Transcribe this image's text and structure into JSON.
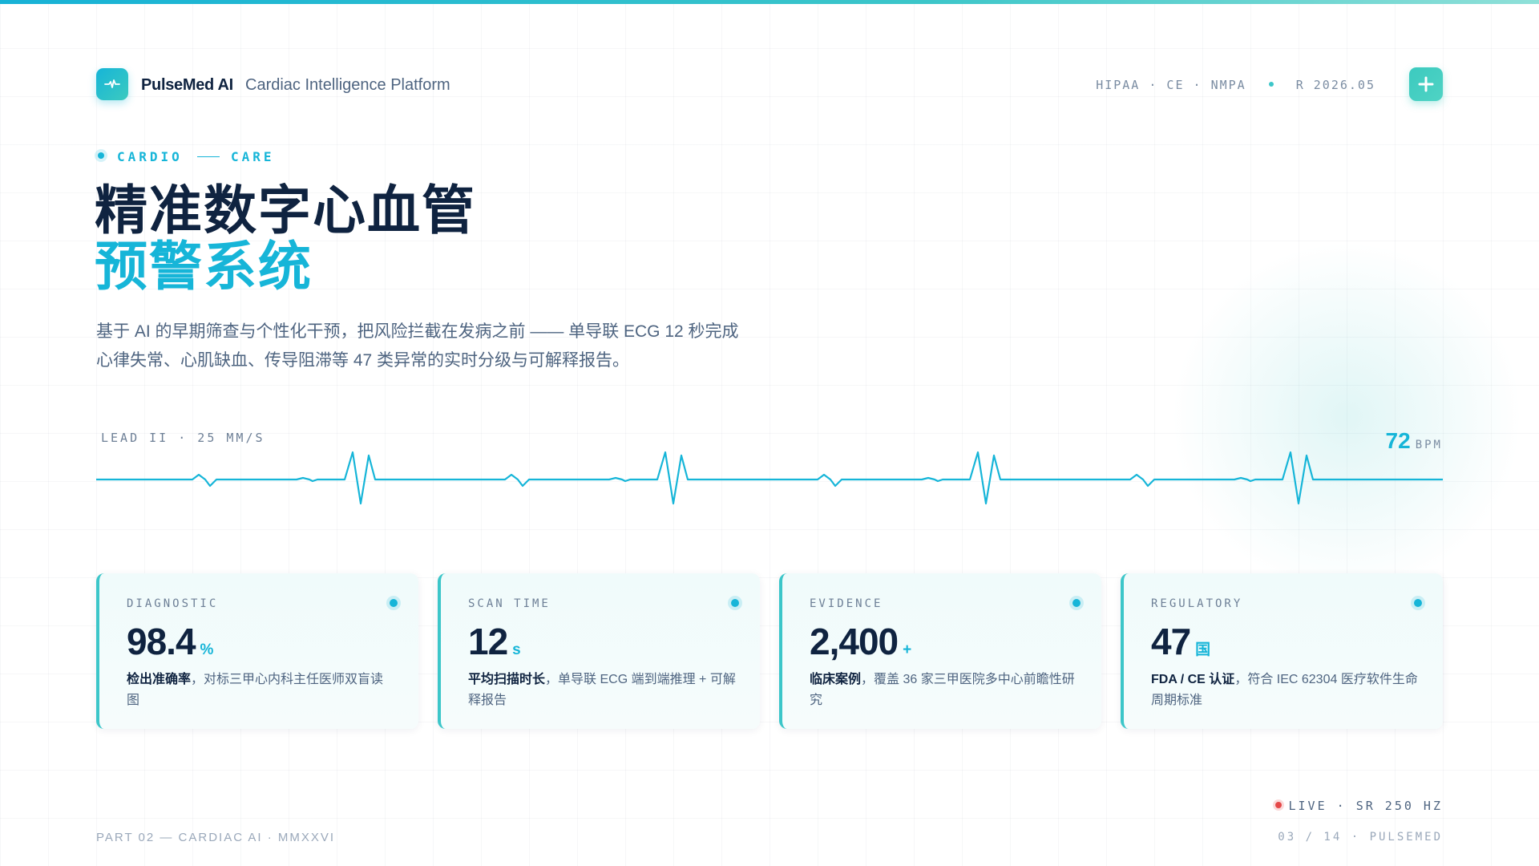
{
  "header": {
    "brand": "PulseMed AI",
    "platform": "Cardiac Intelligence Platform",
    "compliance": "HIPAA · CE · NMPA",
    "release": "R 2026.05",
    "logo_icon": "pulse-icon",
    "action_icon": "plus-icon"
  },
  "hero": {
    "eyebrow_left": "CARDIO",
    "eyebrow_right": "CARE",
    "title_line1": "精准数字心血管",
    "title_line2": "预警系统",
    "description_line1": "基于 AI 的早期筛查与个性化干预，把风险拦截在发病之前 —— 单导联 ECG 12 秒完成",
    "description_line2": "心律失常、心肌缺血、传导阻滞等 47 类异常的实时分级与可解释报告。"
  },
  "ecg": {
    "lead_label": "LEAD II · 25 MM/S",
    "bpm_value": "72",
    "bpm_unit": "BPM"
  },
  "cards": [
    {
      "label": "DIAGNOSTIC",
      "value": "98.4",
      "unit": "%",
      "desc_bold": "检出准确率",
      "desc_rest": "，对标三甲心内科主任医师双盲读图"
    },
    {
      "label": "SCAN TIME",
      "value": "12",
      "unit": "s",
      "desc_bold": "平均扫描时长",
      "desc_rest": "，单导联 ECG 端到端推理 + 可解释报告"
    },
    {
      "label": "EVIDENCE",
      "value": "2,400",
      "unit": "+",
      "desc_bold": "临床案例",
      "desc_rest": "，覆盖 36 家三甲医院多中心前瞻性研究"
    },
    {
      "label": "REGULATORY",
      "value": "47",
      "unit": "国",
      "desc_bold": "FDA / CE 认证",
      "desc_rest": "，符合 IEC 62304 医疗软件生命周期标准"
    }
  ],
  "footer": {
    "live": "LIVE · SR 250 HZ",
    "left": "PART 02 — CARDIAC AI · MMXXVI",
    "right": "03 / 14 · PULSEMED"
  },
  "colors": {
    "accent": "#16b5d8",
    "teal": "#3cc6c9",
    "navy": "#0f2340",
    "live_red": "#e54848"
  }
}
